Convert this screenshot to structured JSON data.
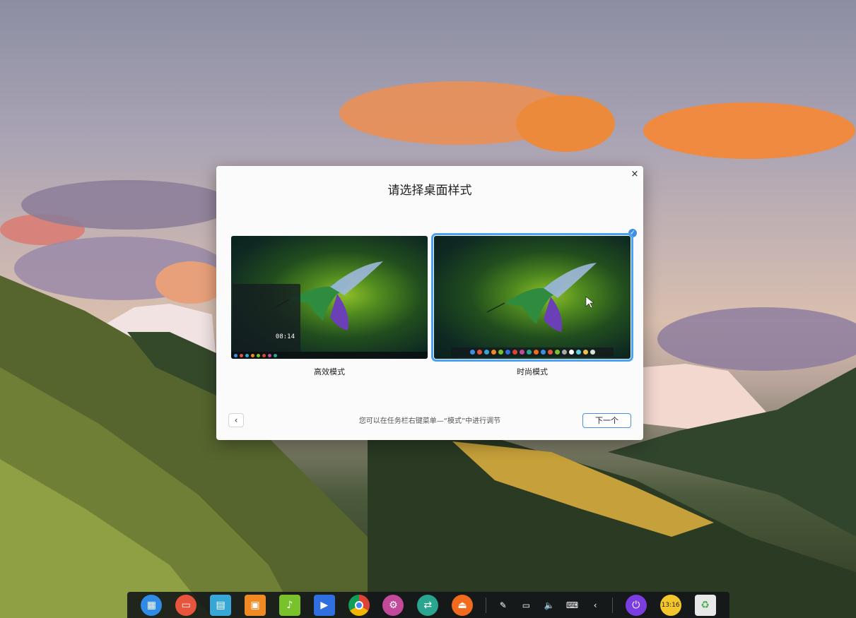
{
  "dialog": {
    "title": "请选择桌面样式",
    "close_glyph": "×",
    "modes": [
      {
        "label": "高效模式",
        "selected": false,
        "clock": "08:14"
      },
      {
        "label": "时尚模式",
        "selected": true
      }
    ],
    "selected_check_glyph": "✓",
    "hint": "您可以在任务栏右键菜单—“模式”中进行调节",
    "back_glyph": "‹",
    "next_label": "下一个"
  },
  "dock": {
    "apps": [
      {
        "name": "launcher-icon",
        "color": "#2f8be6"
      },
      {
        "name": "multitask-icon",
        "color": "#e8553d"
      },
      {
        "name": "file-manager-icon",
        "color": "#37a7d8"
      },
      {
        "name": "app-store-icon",
        "color": "#f08a24"
      },
      {
        "name": "music-icon",
        "color": "#7ac22b"
      },
      {
        "name": "video-icon",
        "color": "#2f6fe0"
      },
      {
        "name": "chrome-icon",
        "color": "#db4437"
      },
      {
        "name": "settings-icon",
        "color": "#c34a9a"
      },
      {
        "name": "remote-assist-icon",
        "color": "#2aa58f"
      },
      {
        "name": "installer-icon",
        "color": "#f26b1d"
      }
    ],
    "tray": [
      {
        "name": "pen-icon",
        "glyph": "✎"
      },
      {
        "name": "battery-icon",
        "glyph": "▭"
      },
      {
        "name": "volume-icon",
        "glyph": "🔈"
      },
      {
        "name": "keyboard-icon",
        "glyph": "⌨"
      },
      {
        "name": "tray-expand-icon",
        "glyph": "‹"
      }
    ],
    "power_glyph": "⏻",
    "clock_text": "13:16",
    "trash_name": "trash-icon"
  }
}
